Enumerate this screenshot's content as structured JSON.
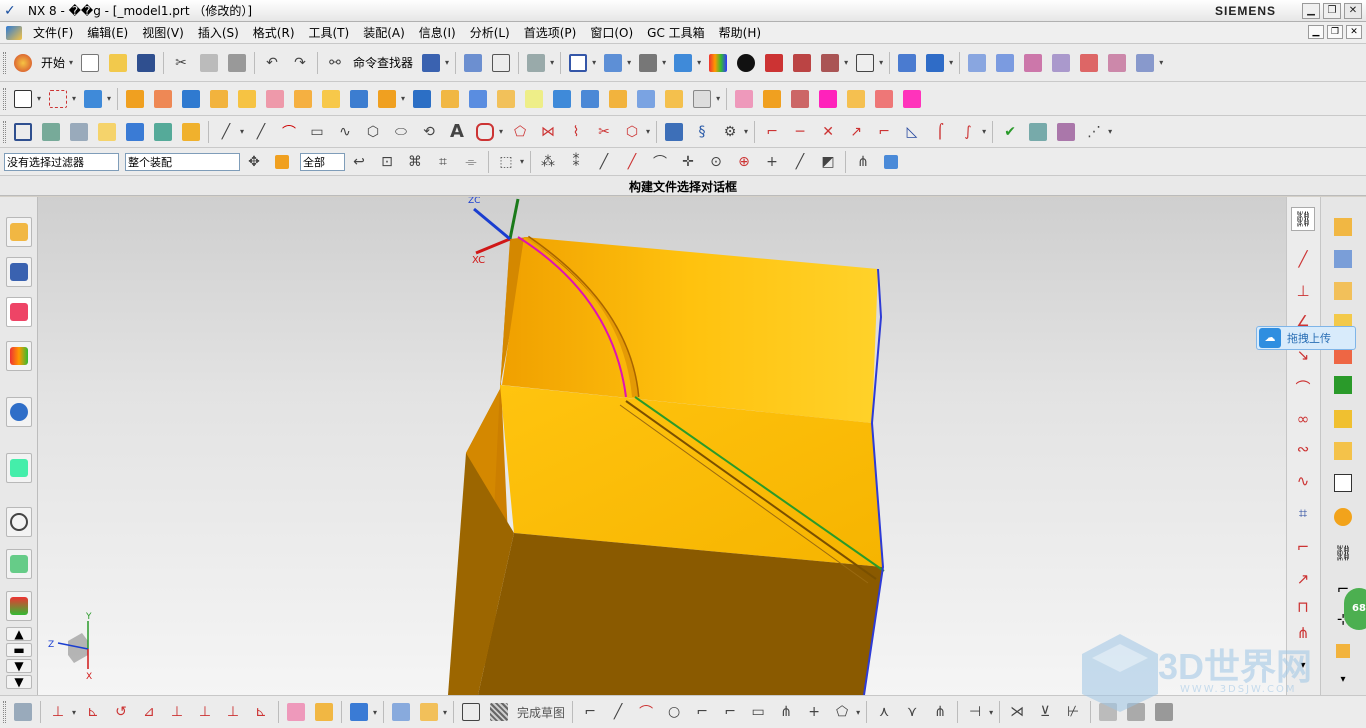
{
  "window": {
    "title": "NX 8 - ��g - [_model1.prt （修改的）]",
    "brand": "SIEMENS"
  },
  "menu": {
    "items": [
      "文件(F)",
      "编辑(E)",
      "视图(V)",
      "插入(S)",
      "格式(R)",
      "工具(T)",
      "装配(A)",
      "信息(I)",
      "分析(L)",
      "首选项(P)",
      "窗口(O)",
      "GC 工具箱",
      "帮助(H)"
    ]
  },
  "toolbar": {
    "start_label": "开始",
    "command_finder_label": "命令查找器"
  },
  "selection": {
    "filter_value": "没有选择过滤器",
    "assembly_value": "整个装配",
    "scope_value": "全部"
  },
  "status": {
    "message": "构建文件选择对话框"
  },
  "viewport": {
    "triad_top": {
      "z": "ZC",
      "x": "XC"
    },
    "triad_bottom": {
      "y": "Y",
      "z": "Z",
      "x": "X"
    }
  },
  "bottom": {
    "finish_sketch_label": "完成草图"
  },
  "overlay": {
    "upload_label": "拖拽上传",
    "badge_value": "68",
    "watermark_text": "3D世界网",
    "watermark_sub": "WWW.3DSJW.COM"
  },
  "colors": {
    "part_top": "#ffc20e",
    "part_dark": "#8a5a00",
    "part_mid": "#e09a05",
    "edge_blue": "#2e3bd6",
    "curve_magenta": "#e012b4",
    "curve_green": "#2a9a2a"
  }
}
